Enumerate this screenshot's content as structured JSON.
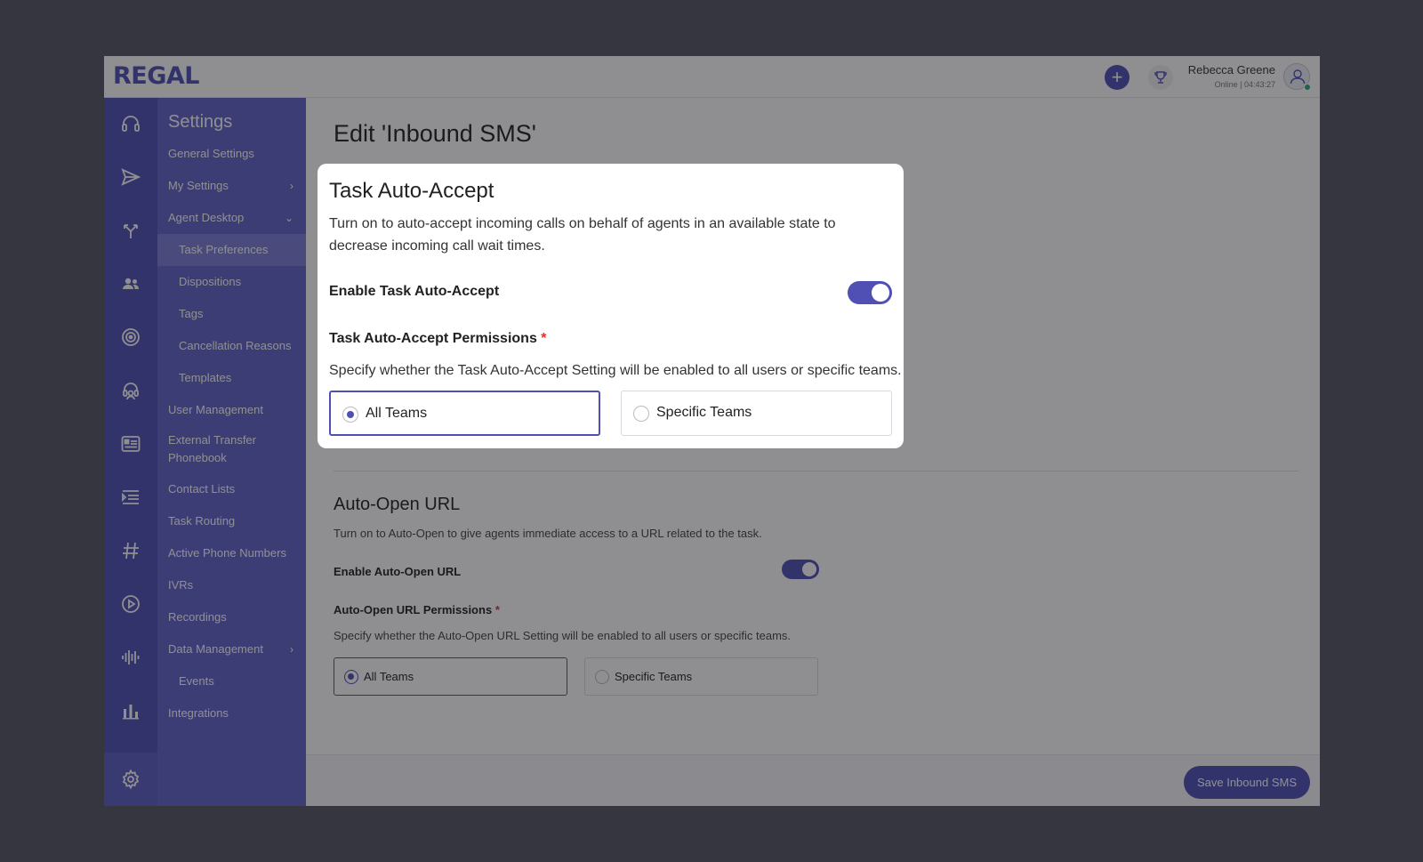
{
  "header": {
    "logo": "REGAL",
    "user_name": "Rebecca Greene",
    "user_status": "Online | 04:43:27"
  },
  "rail": {
    "icons": [
      "headset-icon",
      "send-icon",
      "routing-icon",
      "people-icon",
      "target-icon",
      "agent-icon",
      "id-card-icon",
      "list-icon",
      "hashtag-icon",
      "play-icon",
      "waveform-icon",
      "bar-chart-icon",
      "gear-icon"
    ]
  },
  "settings_nav": {
    "title": "Settings",
    "items": [
      {
        "label": "General Settings"
      },
      {
        "label": "My Settings",
        "chevron": "›"
      },
      {
        "label": "Agent Desktop",
        "chevron": "⌄"
      },
      {
        "label": "Task Preferences",
        "active": true
      },
      {
        "label": "Dispositions"
      },
      {
        "label": "Tags"
      },
      {
        "label": "Cancellation Reasons"
      },
      {
        "label": "Templates"
      },
      {
        "label": "User Management"
      },
      {
        "label": "External Transfer Phonebook"
      },
      {
        "label": "Contact Lists"
      },
      {
        "label": "Task Routing"
      },
      {
        "label": "Active Phone Numbers"
      },
      {
        "label": "IVRs"
      },
      {
        "label": "Recordings"
      },
      {
        "label": "Data Management",
        "chevron": "›"
      },
      {
        "label": "Events"
      },
      {
        "label": "Integrations"
      }
    ]
  },
  "main": {
    "page_title": "Edit 'Inbound SMS'",
    "auto_open": {
      "title": "Auto-Open URL",
      "description": "Turn on to Auto-Open to give agents immediate access to a URL related to the task.",
      "toggle_label": "Enable  Auto-Open URL",
      "toggle_on": true,
      "permissions_label": "Auto-Open URL Permissions",
      "required_mark": "*",
      "permissions_desc": "Specify whether the Auto-Open URL Setting will be enabled to all users or specific teams.",
      "options": [
        "All Teams",
        "Specific Teams"
      ],
      "selected": "All Teams"
    },
    "save_button": "Save Inbound SMS"
  },
  "modal": {
    "title": "Task Auto-Accept",
    "description": "Turn on to auto-accept incoming calls on behalf of agents in an available state to decrease incoming call wait times.",
    "toggle_label": "Enable Task Auto-Accept",
    "toggle_on": true,
    "permissions_label": "Task Auto-Accept Permissions",
    "required_mark": "*",
    "permissions_desc": "Specify whether the Task Auto-Accept Setting will be enabled to all users or specific teams.",
    "options": [
      "All Teams",
      "Specific Teams"
    ],
    "selected": "All Teams"
  },
  "colors": {
    "brand": "#4f4fb4",
    "nav_bg": "#6262c9",
    "required": "#e03030"
  }
}
